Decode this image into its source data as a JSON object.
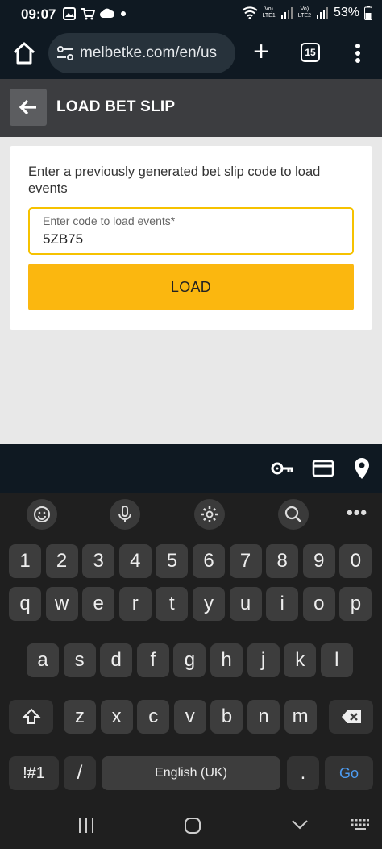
{
  "status_bar": {
    "time": "09:07",
    "battery": "53%"
  },
  "browser": {
    "url": "melbetke.com/en/us",
    "tab_count": "15"
  },
  "page": {
    "title": "LOAD BET SLIP",
    "description": "Enter a previously generated bet slip code to load events",
    "code_field": {
      "label": "Enter code to load events*",
      "value": "5ZB75"
    },
    "load_button": "LOAD"
  },
  "keyboard": {
    "number_row": [
      "1",
      "2",
      "3",
      "4",
      "5",
      "6",
      "7",
      "8",
      "9",
      "0"
    ],
    "row1": [
      "q",
      "w",
      "e",
      "r",
      "t",
      "y",
      "u",
      "i",
      "o",
      "p"
    ],
    "row2": [
      "a",
      "s",
      "d",
      "f",
      "g",
      "h",
      "j",
      "k",
      "l"
    ],
    "row3": [
      "z",
      "x",
      "c",
      "v",
      "b",
      "n",
      "m"
    ],
    "symbols_key": "!#1",
    "slash_key": "/",
    "space_label": "English (UK)",
    "period_key": ".",
    "go_key": "Go"
  },
  "colors": {
    "accent_yellow": "#fbb70f",
    "field_border": "#f6c200",
    "header_bg": "#3c3d40",
    "go_blue": "#4d9cf2"
  }
}
